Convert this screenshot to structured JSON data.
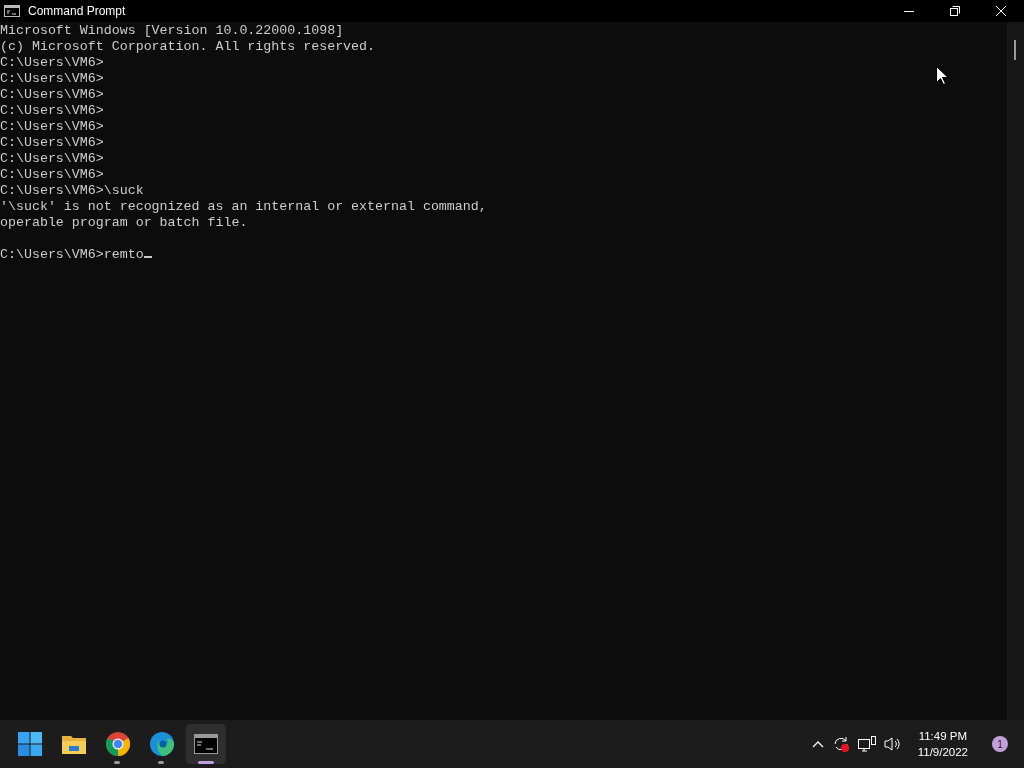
{
  "window": {
    "title": "Command Prompt"
  },
  "console": {
    "lines": [
      {
        "text": "Microsoft Windows [Version 10.0.22000.1098]"
      },
      {
        "text": "(c) Microsoft Corporation. All rights reserved."
      },
      {
        "text": "C:\\Users\\VM6>"
      },
      {
        "text": "C:\\Users\\VM6>"
      },
      {
        "text": "C:\\Users\\VM6>"
      },
      {
        "text": "C:\\Users\\VM6>"
      },
      {
        "text": "C:\\Users\\VM6>"
      },
      {
        "text": "C:\\Users\\VM6>"
      },
      {
        "text": "C:\\Users\\VM6>"
      },
      {
        "text": "C:\\Users\\VM6>"
      },
      {
        "text": "C:\\Users\\VM6>\\suck"
      },
      {
        "text": "'\\suck' is not recognized as an internal or external command,"
      },
      {
        "text": "operable program or batch file."
      }
    ],
    "prompt": {
      "text": "C:\\Users\\VM6>remto",
      "blank_before": true
    }
  },
  "taskbar": {
    "apps": [
      {
        "kind": "start",
        "running": false,
        "selected": false
      },
      {
        "kind": "folder",
        "running": false,
        "selected": false
      },
      {
        "kind": "chrome",
        "running": true,
        "selected": false
      },
      {
        "kind": "edge",
        "running": true,
        "selected": false
      },
      {
        "kind": "terminal",
        "running": true,
        "selected": true
      }
    ],
    "clock": {
      "time": "11:49 PM",
      "date": "11/9/2022"
    },
    "notifications": "1"
  }
}
